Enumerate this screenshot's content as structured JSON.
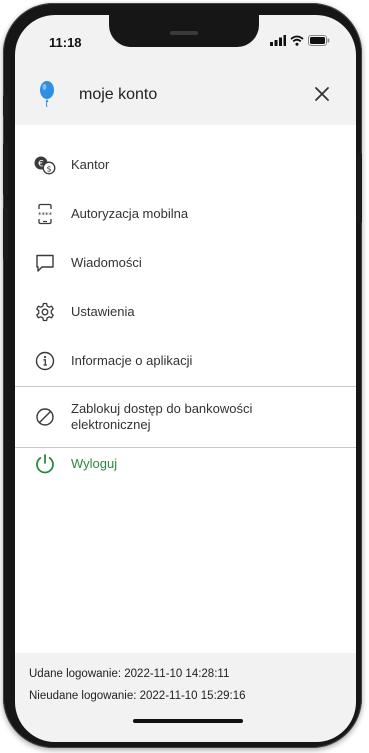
{
  "status_bar": {
    "time": "11:18"
  },
  "header": {
    "title": "moje konto",
    "close_icon": "close-icon",
    "logo_icon": "balloon-logo-icon"
  },
  "menu": {
    "items": [
      {
        "label": "Kantor",
        "icon": "currency-exchange-icon"
      },
      {
        "label": "Autoryzacja mobilna",
        "icon": "mobile-authorization-icon"
      },
      {
        "label": "Wiadomości",
        "icon": "messages-icon"
      },
      {
        "label": "Ustawienia",
        "icon": "settings-gear-icon"
      },
      {
        "label": "Informacje o aplikacji",
        "icon": "info-icon"
      },
      {
        "label": "Zablokuj dostęp do bankowości",
        "label_line2": "elektronicznej",
        "icon": "block-icon"
      },
      {
        "label": "Wyloguj",
        "icon": "power-icon"
      }
    ]
  },
  "footer": {
    "success_login": "Udane logowanie: 2022-11-10 14:28:11",
    "failed_login": "Nieudane logowanie: 2022-11-10 15:29:16"
  },
  "colors": {
    "accent_green": "#2a8a3c",
    "logo_blue": "#2f8fe3",
    "background": "#f2f2f3"
  }
}
